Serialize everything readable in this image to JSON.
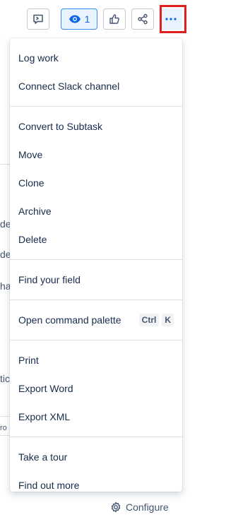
{
  "toolbar": {
    "watch_count": "1"
  },
  "menu": {
    "groups": [
      {
        "items": [
          {
            "label": "Log work"
          },
          {
            "label": "Connect Slack channel"
          }
        ]
      },
      {
        "items": [
          {
            "label": "Convert to Subtask"
          },
          {
            "label": "Move"
          },
          {
            "label": "Clone"
          },
          {
            "label": "Archive"
          },
          {
            "label": "Delete"
          }
        ]
      },
      {
        "items": [
          {
            "label": "Find your field"
          }
        ]
      },
      {
        "items": [
          {
            "label": "Open command palette",
            "shortcut": [
              "Ctrl",
              "K"
            ]
          }
        ]
      },
      {
        "items": [
          {
            "label": "Print"
          },
          {
            "label": "Export Word"
          },
          {
            "label": "Export XML"
          }
        ]
      },
      {
        "items": [
          {
            "label": "Take a tour"
          },
          {
            "label": "Find out more"
          }
        ]
      }
    ]
  },
  "configure": {
    "label": "Configure"
  },
  "background": {
    "fragments": [
      "de",
      "de",
      "ha",
      "tic",
      "ro"
    ]
  },
  "colors": {
    "accent": "#0c66e4",
    "highlight": "#e01e1e",
    "text": "#172b4d"
  }
}
